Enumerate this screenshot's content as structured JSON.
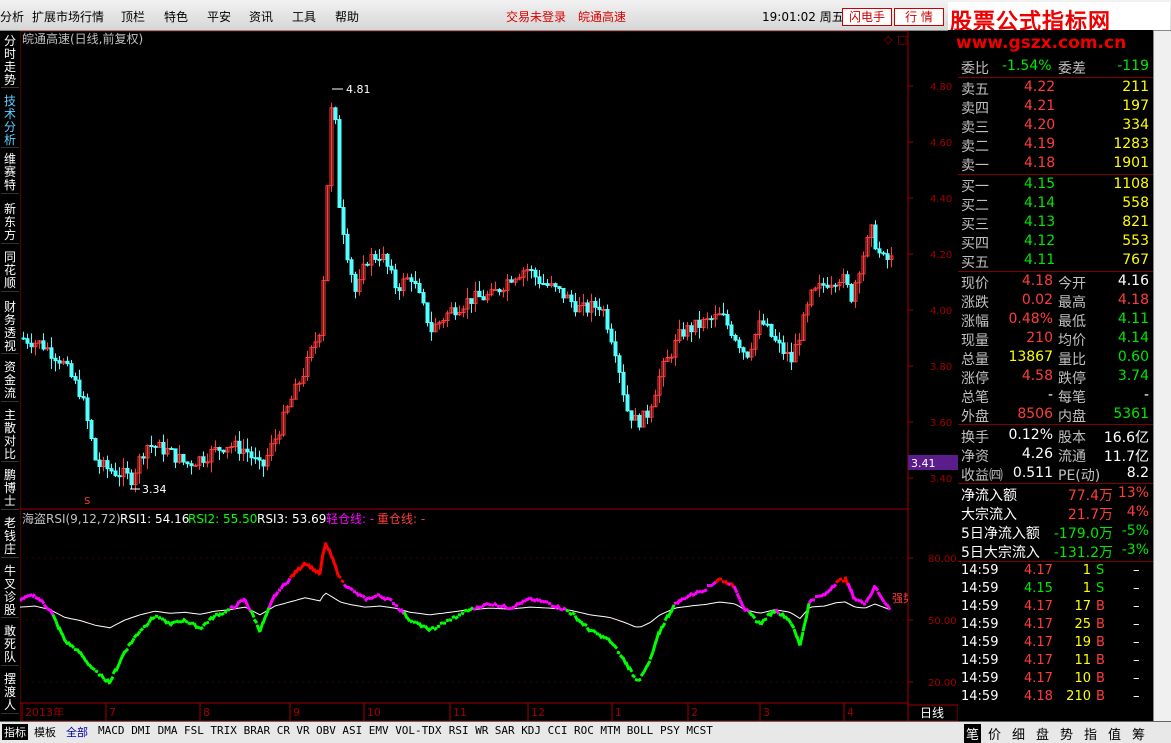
{
  "menu": [
    "分析",
    "扩展市场行情",
    "顶栏",
    "特色",
    "平安",
    "资讯",
    "工具",
    "帮助"
  ],
  "status": {
    "login": "交易未登录",
    "stock": "皖通高速"
  },
  "clock": "19:01:02 周五",
  "buttons": {
    "flash": "闪电手",
    "quote": "行 情"
  },
  "brand": {
    "line1": "股票公式指标网",
    "line2": "www.gszx.com.cn"
  },
  "left_tabs": [
    "分时走势",
    "技术分析",
    "维赛特",
    "新东方",
    "同花顺",
    "财务透视",
    "资金流",
    "主散对比",
    "鹏博士",
    "老钱庄",
    "牛叉诊股",
    "敢死队",
    "摆渡人"
  ],
  "chart": {
    "title": "皖通高速(日线,前复权)",
    "high_label": "4.81",
    "low_label": "3.34",
    "price_ticks": [
      "4.80",
      "4.60",
      "4.40",
      "4.20",
      "4.00",
      "3.80",
      "3.60",
      "3.40"
    ],
    "current_price_tag": "3.41",
    "ind_title": "海盗RSI(9,12,72)",
    "rsi1": "RSI1: 54.16",
    "rsi2": "RSI2: 55.50",
    "rsi3": "RSI3: 53.69",
    "light": "轻仓线: -",
    "heavy": "重仓线: -",
    "ind_ticks": [
      "80.00",
      "50.00",
      "20.00"
    ],
    "strong_label": "强势",
    "x_labels": [
      "2013年",
      "7",
      "8",
      "9",
      "10",
      "11",
      "12",
      "1",
      "2",
      "3",
      "4"
    ],
    "period": "日线",
    "colors": {
      "up": "#ff3c3c",
      "down": "#54ffff",
      "rsi_red": "#ff0000",
      "rsi_green": "#00ff00",
      "rsi_magenta": "#ff00ff",
      "axis": "#a00000"
    }
  },
  "quote": {
    "weibi": {
      "label": "委比",
      "val": "-1.54%",
      "label2": "委差",
      "val2": "-119"
    },
    "asks": [
      {
        "label": "卖五",
        "price": "4.22",
        "vol": "211"
      },
      {
        "label": "卖四",
        "price": "4.21",
        "vol": "197"
      },
      {
        "label": "卖三",
        "price": "4.20",
        "vol": "334"
      },
      {
        "label": "卖二",
        "price": "4.19",
        "vol": "1283"
      },
      {
        "label": "卖一",
        "price": "4.18",
        "vol": "1901"
      }
    ],
    "bids": [
      {
        "label": "买一",
        "price": "4.15",
        "vol": "1108"
      },
      {
        "label": "买二",
        "price": "4.14",
        "vol": "558"
      },
      {
        "label": "买三",
        "price": "4.13",
        "vol": "821"
      },
      {
        "label": "买四",
        "price": "4.12",
        "vol": "553"
      },
      {
        "label": "买五",
        "price": "4.11",
        "vol": "767"
      }
    ],
    "stats": [
      {
        "l1": "现价",
        "v1": "4.18",
        "c1": "red",
        "l2": "今开",
        "v2": "4.16",
        "c2": "white"
      },
      {
        "l1": "涨跌",
        "v1": "0.02",
        "c1": "red",
        "l2": "最高",
        "v2": "4.18",
        "c2": "red"
      },
      {
        "l1": "涨幅",
        "v1": "0.48%",
        "c1": "red",
        "l2": "最低",
        "v2": "4.11",
        "c2": "green"
      },
      {
        "l1": "现量",
        "v1": "210",
        "c1": "red",
        "l2": "均价",
        "v2": "4.14",
        "c2": "green"
      },
      {
        "l1": "总量",
        "v1": "13867",
        "c1": "yellow",
        "l2": "量比",
        "v2": "0.60",
        "c2": "green"
      },
      {
        "l1": "涨停",
        "v1": "4.58",
        "c1": "red",
        "l2": "跌停",
        "v2": "3.74",
        "c2": "green"
      },
      {
        "l1": "总笔",
        "v1": "-",
        "c1": "white",
        "l2": "每笔",
        "v2": "-",
        "c2": "white"
      },
      {
        "l1": "外盘",
        "v1": "8506",
        "c1": "red",
        "l2": "内盘",
        "v2": "5361",
        "c2": "green"
      }
    ],
    "stats2": [
      {
        "l1": "换手",
        "v1": "0.12%",
        "l2": "股本",
        "v2": "16.6亿"
      },
      {
        "l1": "净资",
        "v1": "4.26",
        "l2": "流通",
        "v2": "11.7亿"
      },
      {
        "l1": "收益㈣",
        "v1": "0.511",
        "l2": "PE(动)",
        "v2": "8.2"
      }
    ],
    "flows": [
      {
        "label": "净流入额",
        "val": "77.4万",
        "pct": "13%",
        "c": "red"
      },
      {
        "label": "大宗流入",
        "val": "21.7万",
        "pct": "4%",
        "c": "red"
      },
      {
        "label": "5日净流入额",
        "val": "-179.0万",
        "pct": "-5%",
        "c": "green"
      },
      {
        "label": "5日大宗流入",
        "val": "-131.2万",
        "pct": "-3%",
        "c": "green"
      }
    ],
    "ticks": [
      {
        "t": "14:59",
        "p": "4.17",
        "pc": "red",
        "v": "1",
        "bs": "S",
        "bc": "green",
        "x": "–"
      },
      {
        "t": "14:59",
        "p": "4.15",
        "pc": "green",
        "v": "1",
        "bs": "S",
        "bc": "green",
        "x": "–"
      },
      {
        "t": "14:59",
        "p": "4.17",
        "pc": "red",
        "v": "17",
        "bs": "B",
        "bc": "red",
        "x": "–"
      },
      {
        "t": "14:59",
        "p": "4.17",
        "pc": "red",
        "v": "25",
        "bs": "B",
        "bc": "red",
        "x": "–"
      },
      {
        "t": "14:59",
        "p": "4.17",
        "pc": "red",
        "v": "19",
        "bs": "B",
        "bc": "red",
        "x": "–"
      },
      {
        "t": "14:59",
        "p": "4.17",
        "pc": "red",
        "v": "11",
        "bs": "B",
        "bc": "red",
        "x": "–"
      },
      {
        "t": "14:59",
        "p": "4.17",
        "pc": "red",
        "v": "10",
        "bs": "B",
        "bc": "red",
        "x": "–"
      },
      {
        "t": "14:59",
        "p": "4.18",
        "pc": "red",
        "v": "210",
        "bs": "B",
        "bc": "red",
        "x": "–"
      }
    ]
  },
  "bottom_tabs": [
    "指标",
    "模板",
    "全部",
    "MACD",
    "DMI",
    "DMA",
    "FSL",
    "TRIX",
    "BRAR",
    "CR",
    "VR",
    "OBV",
    "ASI",
    "EMV",
    "VOL-TDX",
    "RSI",
    "WR",
    "SAR",
    "KDJ",
    "CCI",
    "ROC",
    "MTM",
    "BOLL",
    "PSY",
    "MCST"
  ],
  "right_bottom_tabs": [
    "笔",
    "价",
    "细",
    "盘",
    "势",
    "指",
    "值",
    "筹"
  ]
}
